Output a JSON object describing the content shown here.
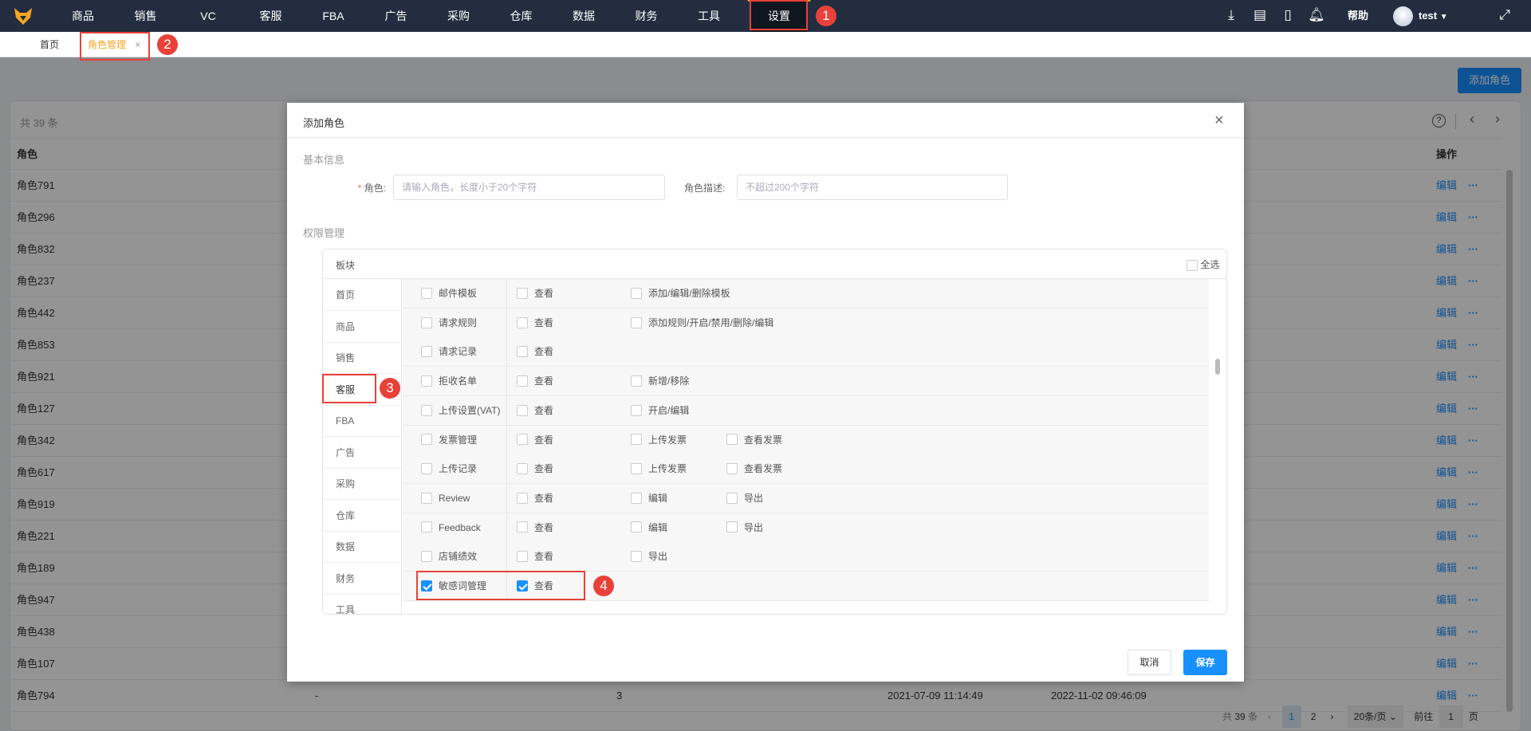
{
  "topnav": {
    "items": [
      "商品",
      "销售",
      "VC",
      "客服",
      "FBA",
      "广告",
      "采购",
      "仓库",
      "数据",
      "财务",
      "工具",
      "设置"
    ],
    "active": "设置",
    "help": "帮助",
    "user": "test"
  },
  "tabs": {
    "home": "首页",
    "current": "角色管理",
    "close": "×"
  },
  "page": {
    "add_button": "添加角色",
    "total": "共 39 条",
    "col_role": "角色",
    "col_action": "操作",
    "edit": "编辑",
    "more": "···",
    "roles": [
      "角色791",
      "角色296",
      "角色832",
      "角色237",
      "角色442",
      "角色853",
      "角色921",
      "角色127",
      "角色342",
      "角色617",
      "角色919",
      "角色221",
      "角色189",
      "角色947",
      "角色438",
      "角色107",
      "角色794"
    ],
    "last_row": {
      "desc": "-",
      "count": "3",
      "created": "2021-07-09 11:14:49",
      "updated": "2022-11-02 09:46:09"
    },
    "pagination": {
      "total_prefix": "共",
      "total": "39",
      "total_suffix": "条",
      "pages": [
        "1",
        "2"
      ],
      "current": "1",
      "page_size": "20条/页",
      "goto": "前往",
      "goto_value": "1",
      "page_suffix": "页"
    }
  },
  "modal": {
    "title": "添加角色",
    "section_basic": "基本信息",
    "role_label": "角色:",
    "required_mark": "*",
    "role_placeholder": "请输入角色，长度小于20个字符",
    "desc_label": "角色描述:",
    "desc_placeholder": "不超过200个字符",
    "section_perm": "权限管理",
    "module_header": "板块",
    "select_all": "全选",
    "modules": [
      "首页",
      "商品",
      "销售",
      "客服",
      "FBA",
      "广告",
      "采购",
      "仓库",
      "数据",
      "财务",
      "工具"
    ],
    "active_module": "客服",
    "permissions": [
      {
        "name": "邮件模板",
        "checked": false,
        "ops": [
          {
            "label": "查看",
            "checked": false
          },
          {
            "label": "添加/编辑/删除模板",
            "checked": false
          }
        ]
      },
      {
        "name": "请求规则",
        "checked": false,
        "ops": [
          {
            "label": "查看",
            "checked": false
          },
          {
            "label": "添加规则/开启/禁用/删除/编辑",
            "checked": false
          }
        ]
      },
      {
        "name": "请求记录",
        "checked": false,
        "ops": [
          {
            "label": "查看",
            "checked": false
          }
        ]
      },
      {
        "name": "拒收名单",
        "checked": false,
        "ops": [
          {
            "label": "查看",
            "checked": false
          },
          {
            "label": "新增/移除",
            "checked": false
          }
        ]
      },
      {
        "name": "上传设置(VAT)",
        "checked": false,
        "ops": [
          {
            "label": "查看",
            "checked": false
          },
          {
            "label": "开启/编辑",
            "checked": false
          }
        ]
      },
      {
        "name": "发票管理",
        "checked": false,
        "ops": [
          {
            "label": "查看",
            "checked": false
          },
          {
            "label": "上传发票",
            "checked": false
          },
          {
            "label": "查看发票",
            "checked": false
          }
        ]
      },
      {
        "name": "上传记录",
        "checked": false,
        "ops": [
          {
            "label": "查看",
            "checked": false
          },
          {
            "label": "上传发票",
            "checked": false
          },
          {
            "label": "查看发票",
            "checked": false
          }
        ]
      },
      {
        "name": "Review",
        "checked": false,
        "ops": [
          {
            "label": "查看",
            "checked": false
          },
          {
            "label": "编辑",
            "checked": false
          },
          {
            "label": "导出",
            "checked": false
          }
        ]
      },
      {
        "name": "Feedback",
        "checked": false,
        "ops": [
          {
            "label": "查看",
            "checked": false
          },
          {
            "label": "编辑",
            "checked": false
          },
          {
            "label": "导出",
            "checked": false
          }
        ]
      },
      {
        "name": "店铺绩效",
        "checked": false,
        "ops": [
          {
            "label": "查看",
            "checked": false
          },
          {
            "label": "导出",
            "checked": false
          }
        ]
      },
      {
        "name": "敏感词管理",
        "checked": true,
        "ops": [
          {
            "label": "查看",
            "checked": true
          }
        ]
      }
    ],
    "cancel": "取消",
    "save": "保存"
  },
  "annotations": [
    "1",
    "2",
    "3",
    "4"
  ],
  "colors": {
    "nav_bg": "#232d3f",
    "accent": "#1890ff",
    "tab_active": "#f5a623",
    "annotation": "#e8413a"
  }
}
